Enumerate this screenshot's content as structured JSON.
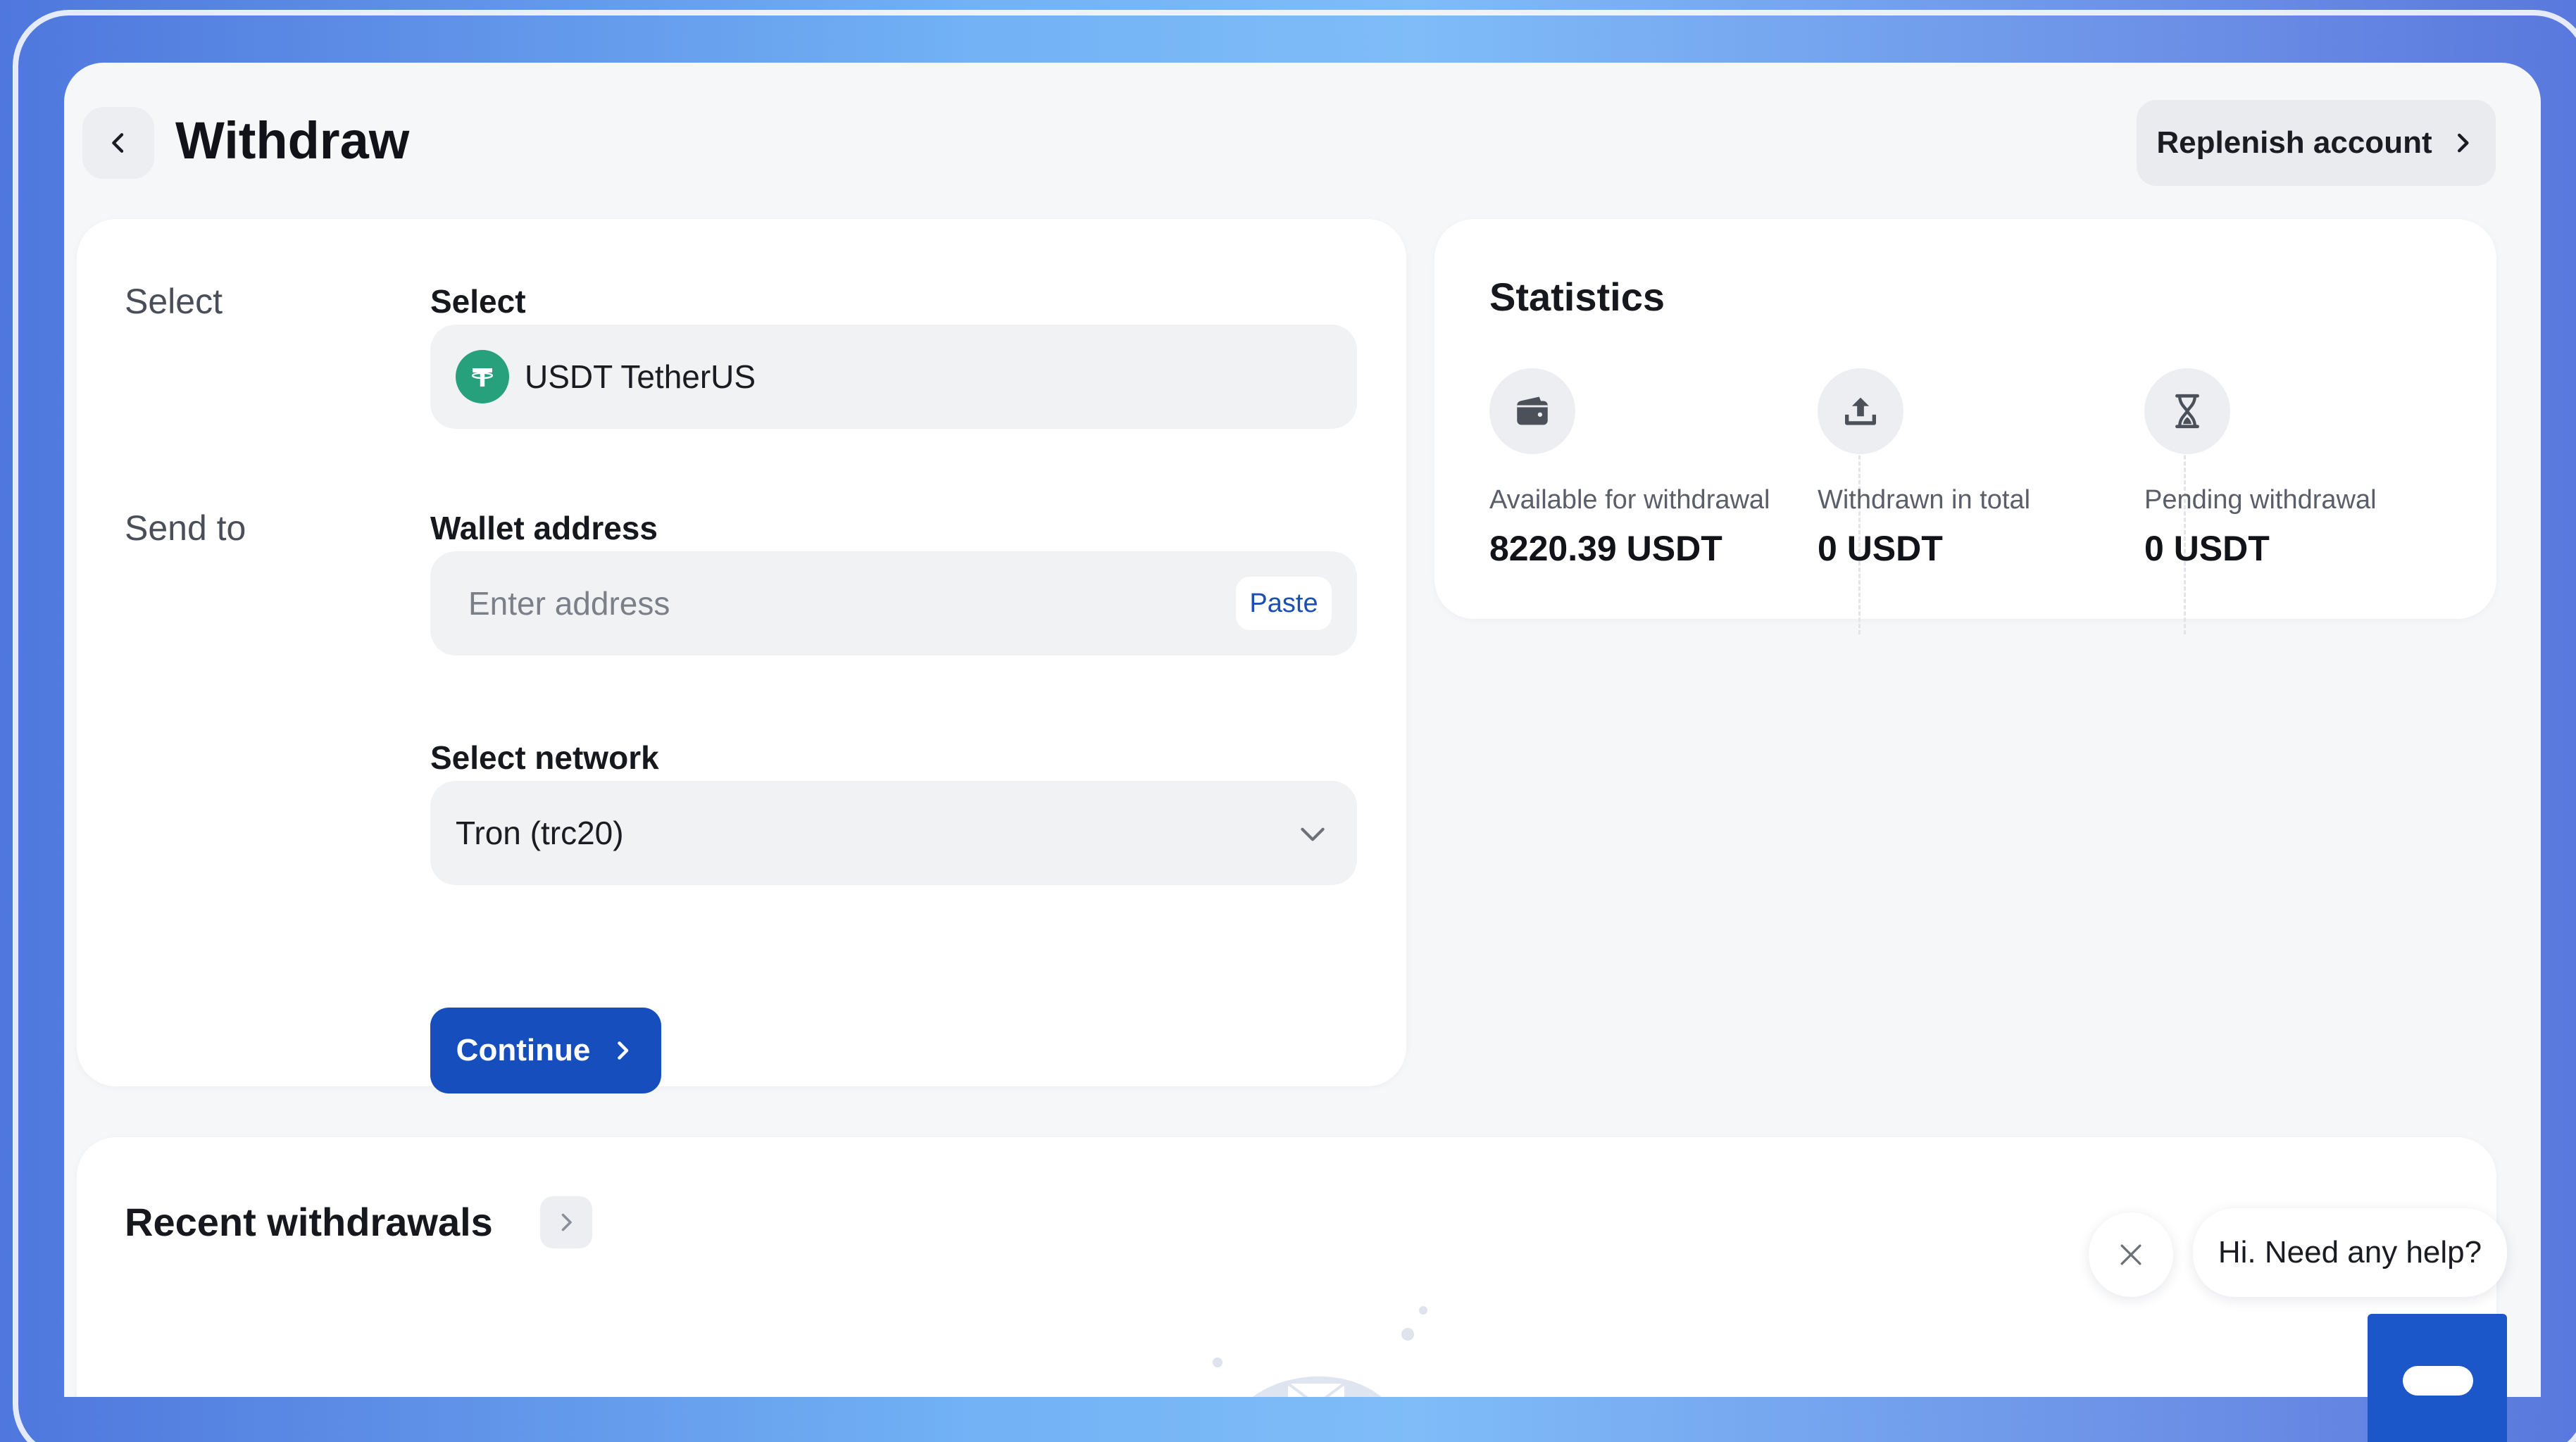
{
  "header": {
    "title": "Withdraw",
    "replenish_label": "Replenish account"
  },
  "form": {
    "select_section": "Select",
    "select_label": "Select",
    "currency": "USDT TetherUS",
    "send_section": "Send to",
    "wallet_label": "Wallet address",
    "wallet_placeholder": "Enter address",
    "wallet_value": "",
    "paste_label": "Paste",
    "network_label": "Select network",
    "network_value": "Tron (trc20)",
    "continue_label": "Continue"
  },
  "statistics": {
    "title": "Statistics",
    "items": [
      {
        "label": "Available for withdrawal",
        "value": "8220.39 USDT",
        "icon": "wallet-icon"
      },
      {
        "label": "Withdrawn in total",
        "value": "0 USDT",
        "icon": "upload-icon"
      },
      {
        "label": "Pending withdrawal",
        "value": "0 USDT",
        "icon": "hourglass-icon"
      }
    ]
  },
  "recent": {
    "title": "Recent withdrawals"
  },
  "chat": {
    "greeting": "Hi. Need any help?"
  },
  "colors": {
    "primary": "#164fbd",
    "tether": "#26a17b",
    "link": "#1b4fb4"
  }
}
